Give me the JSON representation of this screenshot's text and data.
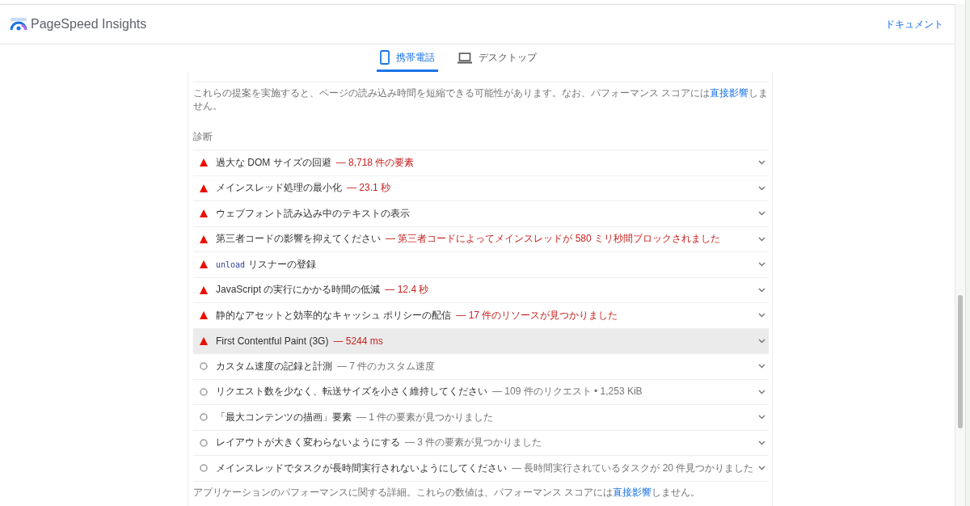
{
  "header": {
    "title": "PageSpeed Insights",
    "link": "ドキュメント"
  },
  "tabs": [
    {
      "label": "携帯電話",
      "selected": true
    },
    {
      "label": "デスクトップ",
      "selected": false
    }
  ],
  "opportunities_note": {
    "before": "これらの提案を実施すると、ページの読み込み時間を短縮できる可能性があります。なお、パフォーマンス スコアには",
    "link": "直接影響",
    "after": "しません。"
  },
  "diagnostics": {
    "heading": "診断",
    "rows": [
      {
        "kind": "fail",
        "title": "過大な DOM サイズの回避",
        "detail": "— 8,718 件の要素",
        "highlighted": false
      },
      {
        "kind": "fail",
        "title": "メインスレッド処理の最小化",
        "detail": "— 23.1 秒",
        "highlighted": false
      },
      {
        "kind": "fail",
        "title": "ウェブフォント読み込み中のテキストの表示",
        "highlighted": false
      },
      {
        "kind": "fail",
        "title": "第三者コードの影響を抑えてください",
        "detail": "— 第三者コードによってメインスレッドが 580 ミリ秒間ブロックされました",
        "highlighted": false
      },
      {
        "kind": "fail",
        "code": "unload",
        "title": "リスナーの登録",
        "highlighted": false
      },
      {
        "kind": "fail",
        "title": "JavaScript の実行にかかる時間の低減",
        "detail": "— 12.4 秒",
        "highlighted": false
      },
      {
        "kind": "fail",
        "title": "静的なアセットと効率的なキャッシュ ポリシーの配信",
        "detail": "— 17 件のリソースが見つかりました",
        "highlighted": false
      },
      {
        "kind": "fail",
        "title": "First Contentful Paint (3G)",
        "detail": "— 5244 ms",
        "highlighted": true
      },
      {
        "kind": "info",
        "title": "カスタム速度の記録と計測",
        "detail": "— 7 件のカスタム速度",
        "highlighted": false
      },
      {
        "kind": "info",
        "title": "リクエスト数を少なく、転送サイズを小さく維持してください",
        "detail": "— 109 件のリクエスト • 1,253 KiB",
        "highlighted": false
      },
      {
        "kind": "info",
        "title": "「最大コンテンツの描画」要素",
        "detail": "— 1 件の要素が見つかりました",
        "highlighted": false
      },
      {
        "kind": "info",
        "title": "レイアウトが大きく変わらないようにする",
        "detail": "— 3 件の要素が見つかりました",
        "highlighted": false
      },
      {
        "kind": "info",
        "title": "メインスレッドでタスクが長時間実行されないようにしてください",
        "detail": "— 長時間実行されているタスクが 20 件見つかりました",
        "highlighted": false
      }
    ],
    "note": {
      "before": "アプリケーションのパフォーマンスに関する詳細。これらの数値は、パフォーマンス スコアには",
      "link": "直接影響",
      "after": "しません。"
    }
  }
}
